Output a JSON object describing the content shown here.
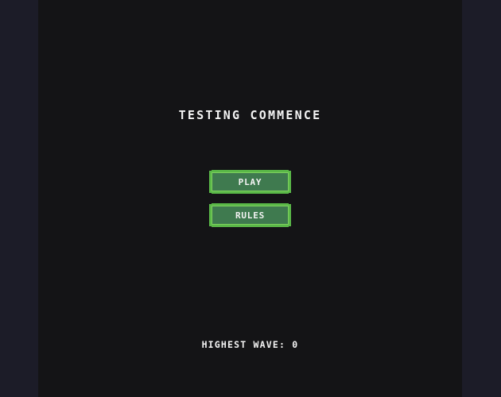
{
  "game": {
    "title": "TESTING COMMENCE",
    "menu": {
      "play_label": "PLAY",
      "rules_label": "RULES"
    },
    "highest_wave_text": "HIGHEST WAVE: 0"
  },
  "colors": {
    "page_background": "#1c1c28",
    "canvas_background": "#141416",
    "button_fill": "#3f7a4f",
    "button_border": "#5ab848",
    "text": "#f4f4f4"
  }
}
